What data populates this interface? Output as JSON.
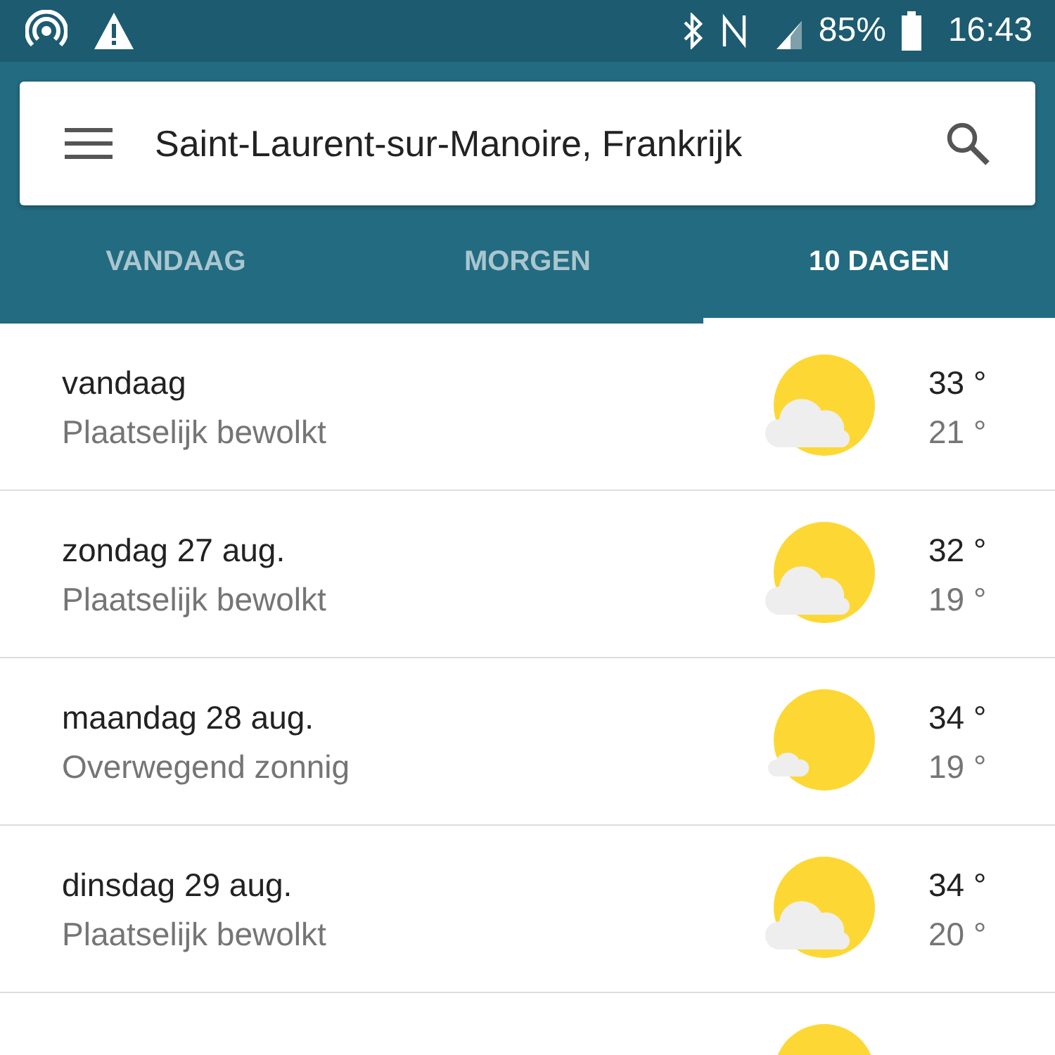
{
  "status_bar": {
    "battery": "85%",
    "time": "16:43"
  },
  "search": {
    "value": "Saint-Laurent-sur-Manoire, Frankrijk"
  },
  "tabs": [
    {
      "label": "VANDAAG",
      "selected": false
    },
    {
      "label": "MORGEN",
      "selected": false
    },
    {
      "label": "10 DAGEN",
      "selected": true
    }
  ],
  "days": [
    {
      "day": "vandaag",
      "condition": "Plaatselijk bewolkt",
      "kind": "partly-cloudy",
      "high": "33 °",
      "low": "21 °"
    },
    {
      "day": "zondag 27 aug.",
      "condition": "Plaatselijk bewolkt",
      "kind": "partly-cloudy",
      "high": "32 °",
      "low": "19 °"
    },
    {
      "day": "maandag 28 aug.",
      "condition": "Overwegend zonnig",
      "kind": "mostly-sunny",
      "high": "34 °",
      "low": "19 °"
    },
    {
      "day": "dinsdag 29 aug.",
      "condition": "Plaatselijk bewolkt",
      "kind": "partly-cloudy",
      "high": "34 °",
      "low": "20 °"
    },
    {
      "kind": "sunny"
    }
  ]
}
